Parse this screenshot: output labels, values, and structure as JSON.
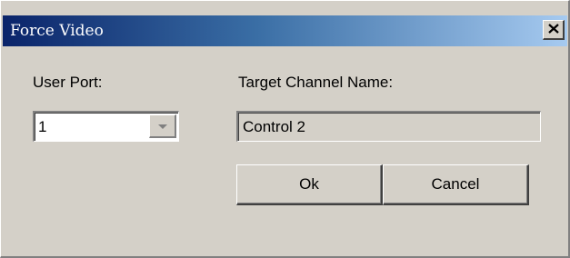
{
  "window": {
    "title": "Force Video",
    "close_glyph": "X"
  },
  "colors": {
    "title_start": "#0a246a",
    "title_end": "#a6caf0",
    "face": "#d4d0c8"
  },
  "user_port": {
    "label": "User Port:",
    "selected": "1"
  },
  "target_channel": {
    "label": "Target Channel Name:",
    "value": "Control 2"
  },
  "buttons": {
    "ok_label": "Ok",
    "cancel_label": "Cancel"
  },
  "icons": {
    "close": "close-icon",
    "dropdown": "chevron-down-icon"
  }
}
